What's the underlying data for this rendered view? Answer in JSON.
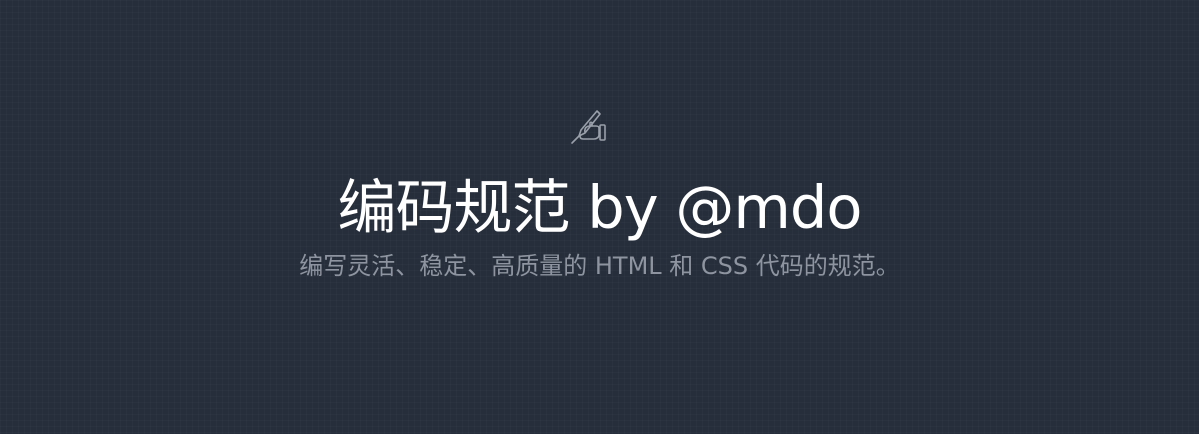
{
  "hero": {
    "icon": "writing-hand-icon",
    "title": "编码规范 by @mdo",
    "subtitle": "编写灵活、稳定、高质量的 HTML 和 CSS 代码的规范。"
  },
  "colors": {
    "background": "#262e3b",
    "title": "#ffffff",
    "subtitle": "#8e95a1",
    "icon": "#9aa0aa"
  }
}
